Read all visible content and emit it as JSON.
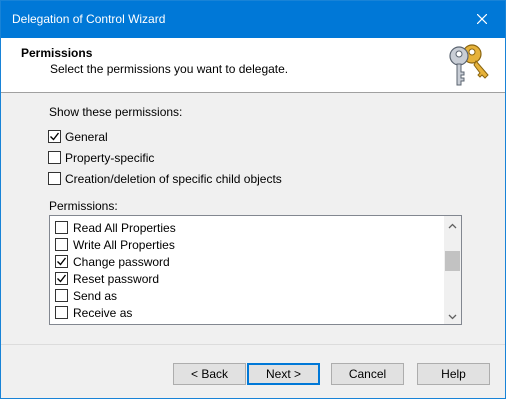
{
  "window": {
    "title": "Delegation of Control Wizard",
    "close_icon": "close-icon"
  },
  "header": {
    "title": "Permissions",
    "subtitle": "Select the permissions you want to delegate.",
    "icon": "keys-icon"
  },
  "show_permissions": {
    "label": "Show these permissions:",
    "options": [
      {
        "label": "General",
        "checked": true
      },
      {
        "label": "Property-specific",
        "checked": false
      },
      {
        "label": "Creation/deletion of specific child objects",
        "checked": false
      }
    ]
  },
  "permissions": {
    "label": "Permissions:",
    "items": [
      {
        "label": "Read All Properties",
        "checked": false
      },
      {
        "label": "Write All Properties",
        "checked": false
      },
      {
        "label": "Change password",
        "checked": true
      },
      {
        "label": "Reset password",
        "checked": true
      },
      {
        "label": "Send as",
        "checked": false
      },
      {
        "label": "Receive as",
        "checked": false
      }
    ]
  },
  "buttons": {
    "back": "< Back",
    "next": "Next >",
    "cancel": "Cancel",
    "help": "Help"
  },
  "colors": {
    "titlebar": "#0078d7",
    "dialog_bg": "#f0f0f0",
    "default_button_border": "#0078d7"
  }
}
